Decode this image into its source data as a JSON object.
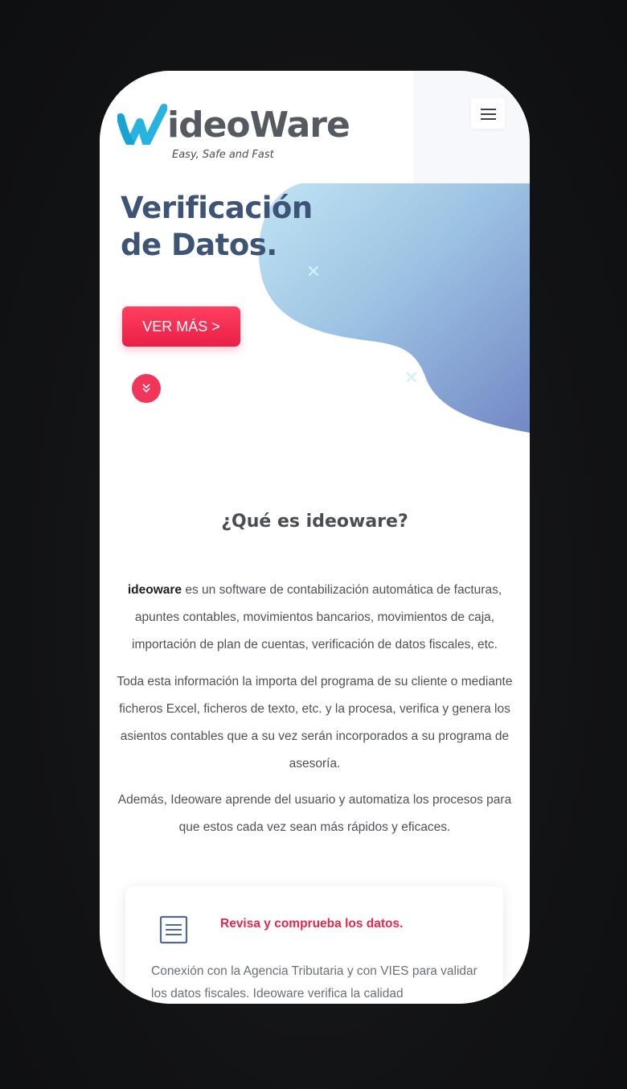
{
  "header": {
    "logo_word": "ideoWare",
    "tagline": "Easy, Safe and Fast",
    "menu_icon": "hamburger-menu-icon"
  },
  "hero": {
    "title_line1": "Verificación",
    "title_line2": "de Datos.",
    "cta_label": "VER MÁS >",
    "scroll_icon": "chevron-double-down-icon"
  },
  "about": {
    "title_prefix": "¿Qué es ",
    "title_brand": "ideoware",
    "title_suffix": "?",
    "p1_brand": "ideoware",
    "p1_text": " es un software de contabilización automática de facturas, apuntes contables, movimientos bancarios, movimientos de caja, importación de plan de cuentas, verificación de datos fiscales, etc.",
    "p2": "Toda esta información la importa del programa de su cliente o mediante ficheros Excel, ficheros de texto, etc. y la procesa, verifica y genera los asientos contables que a su vez serán incorporados a su programa de asesoría.",
    "p3": "Además, Ideoware aprende del usuario y automatiza los procesos para que estos cada vez sean más rápidos y eficaces."
  },
  "feature_card": {
    "icon": "document-lines-icon",
    "title": "Revisa y comprueba los datos.",
    "text": "Conexión con la Agencia Tributaria y con VIES para validar los datos fiscales. Ideoware verifica la calidad"
  },
  "colors": {
    "accent": "#e91f47",
    "hero_title": "#3d5476",
    "blob_start": "#b7def0",
    "blob_end": "#7b8dc8"
  }
}
